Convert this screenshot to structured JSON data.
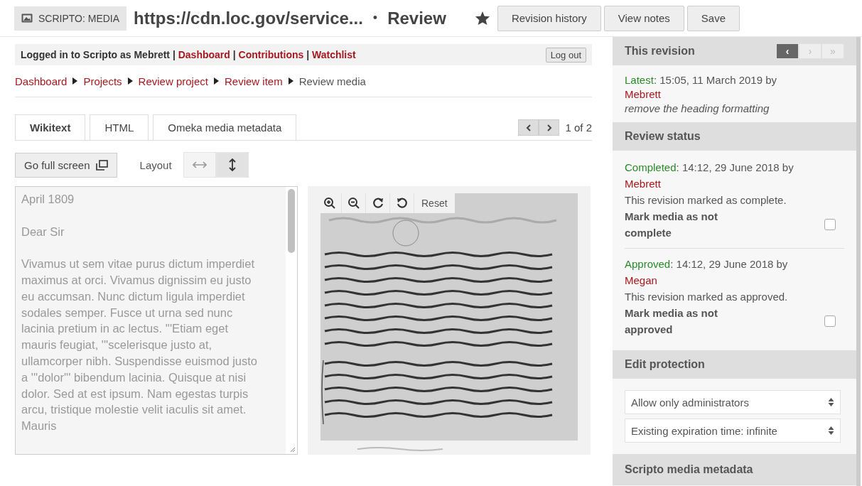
{
  "header": {
    "badge": "SCRIPTO: MEDIA",
    "title": "https://cdn.loc.gov/service...",
    "separator": "•",
    "subtitle": "Review",
    "buttons": [
      "Revision history",
      "View notes",
      "Save"
    ]
  },
  "user_bar": {
    "prefix": "Logged in to Scripto as Mebrett",
    "separator": "|",
    "links": [
      {
        "label": "Dashboard"
      },
      {
        "label": "Contributions"
      },
      {
        "label": "Watchlist"
      }
    ],
    "logout": "Log out"
  },
  "breadcrumbs": [
    {
      "label": "Dashboard",
      "link": true
    },
    {
      "label": "Projects",
      "link": true
    },
    {
      "label": "Review project",
      "link": true
    },
    {
      "label": "Review item",
      "link": true
    },
    {
      "label": "Review media",
      "link": false
    }
  ],
  "tabs": [
    {
      "label": "Wikitext",
      "selected": true
    },
    {
      "label": "HTML",
      "selected": false
    },
    {
      "label": "Omeka media metadata",
      "selected": false
    }
  ],
  "pager": {
    "counter": "1 of 2"
  },
  "toolbar": {
    "fullscreen": "Go full screen",
    "layout_label": "Layout",
    "layouts": [
      {
        "kind": "horizontal",
        "selected": false
      },
      {
        "kind": "vertical",
        "selected": true
      }
    ]
  },
  "editor": {
    "value": "April 1809\n\nDear Sir\n\nVivamus ut sem vitae purus dictum imperdiet maximus at orci. Vivamus dignissim eu justo eu accumsan. Nunc dictum ligula imperdiet\nsodales semper. Fusce ut urna sed nunc lacinia pretium in ac lectus. '''Etiam eget mauris feugiat, '''scelerisque justo at, ullamcorper nibh. Suspendisse euismod justo a '''dolor''' bibendum lacinia. Quisque at nisi dolor. Sed at est ipsum. Nam egestas turpis arcu, tristique molestie velit iaculis sit amet. Mauris"
  },
  "viewer": {
    "kind": "picture",
    "controls": [
      {
        "kind": "zoom-in"
      },
      {
        "kind": "zoom-out"
      },
      {
        "kind": "rotate-right"
      },
      {
        "kind": "rotate-left"
      },
      {
        "kind": "text",
        "label": "Reset"
      }
    ]
  },
  "sidebar": {
    "revision": {
      "title": "This revision",
      "nav": [
        {
          "label": "‹",
          "disabled": false
        },
        {
          "label": "›",
          "disabled": true
        },
        {
          "label": "»",
          "disabled": true
        }
      ],
      "status": "Latest",
      "detail": ": 15:05, 11 March 2019 by",
      "user": "Mebrett",
      "summary": "remove the heading formatting"
    },
    "review": {
      "title": "Review status",
      "items": [
        {
          "status": "Completed",
          "detail": ": 14:12, 29 June 2018 by",
          "user": "Mebrett",
          "note": "This revision marked as complete.",
          "option": "Mark media as not complete",
          "checked": false
        },
        {
          "status": "Approved",
          "detail": ": 14:12, 29 June 2018 by",
          "user": "Megan",
          "note": "This revision marked as approved.",
          "option": "Mark media as not approved",
          "checked": false
        }
      ]
    },
    "protection": {
      "title": "Edit protection",
      "selects": [
        "Allow only administrators",
        "Existing expiration time: infinite"
      ]
    },
    "metadata": {
      "title": "Scripto media metadata"
    }
  }
}
